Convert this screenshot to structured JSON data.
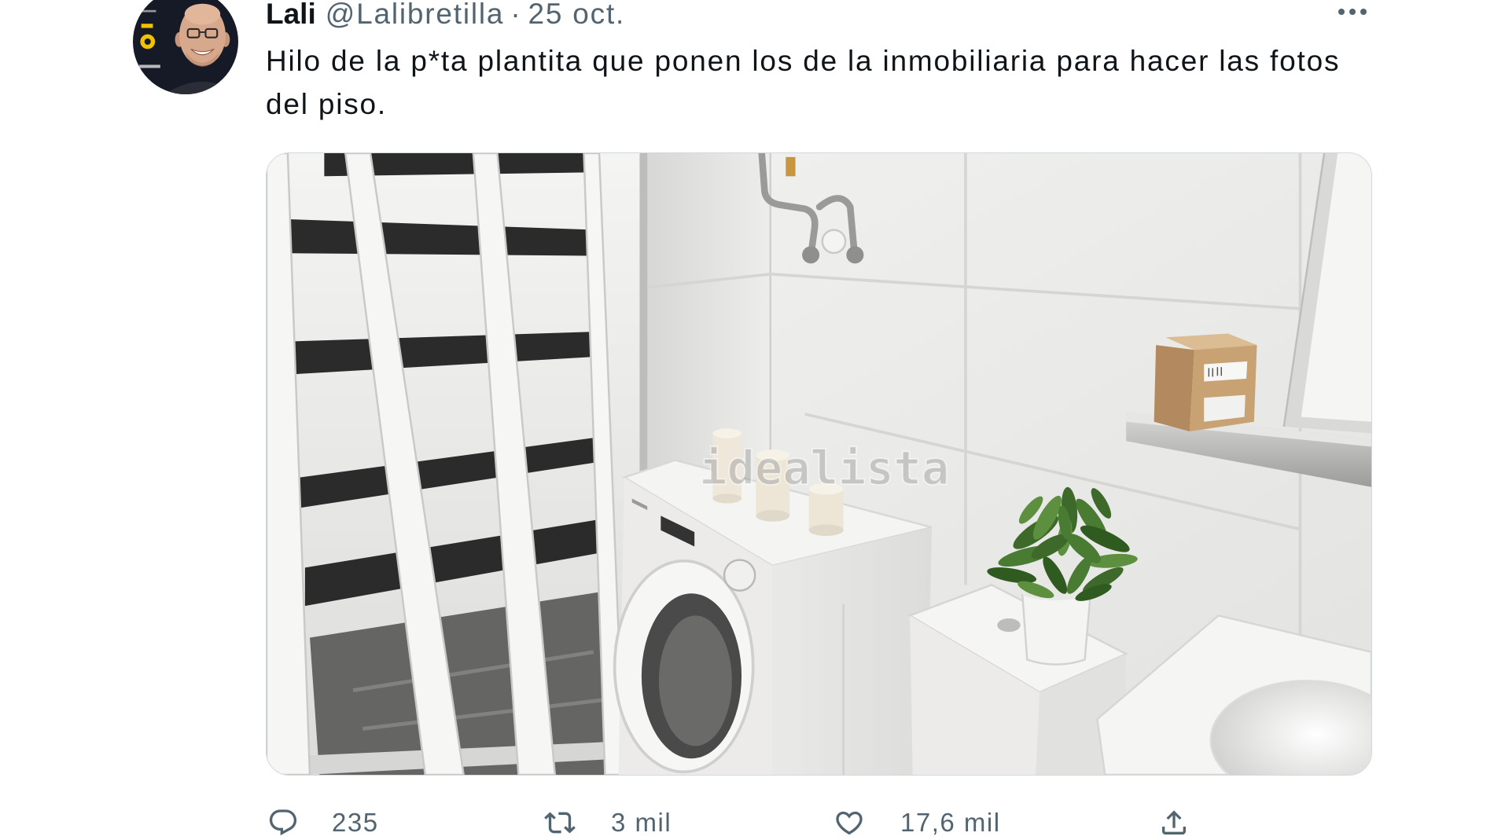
{
  "theme": {
    "text": "#0f1419",
    "secondary": "#536471",
    "border": "#cfd9de",
    "background": "#ffffff"
  },
  "tweet": {
    "author": {
      "name": "Lali",
      "handle": "@Lalibretilla",
      "avatar_icon": "avatar-photo"
    },
    "separator": "·",
    "date": "25 oct.",
    "more_icon": "more-icon",
    "text_lines": [
      "Hilo de la p*ta plantita que ponen los de la inmobiliaria para hacer las fotos",
      "del piso."
    ],
    "media": {
      "watermark": "idealista"
    }
  },
  "actions": {
    "reply": {
      "icon": "reply-icon",
      "count": "235"
    },
    "retweet": {
      "icon": "retweet-icon",
      "count": "3 mil"
    },
    "like": {
      "icon": "like-icon",
      "count": "17,6 mil"
    },
    "share": {
      "icon": "share-icon"
    }
  }
}
